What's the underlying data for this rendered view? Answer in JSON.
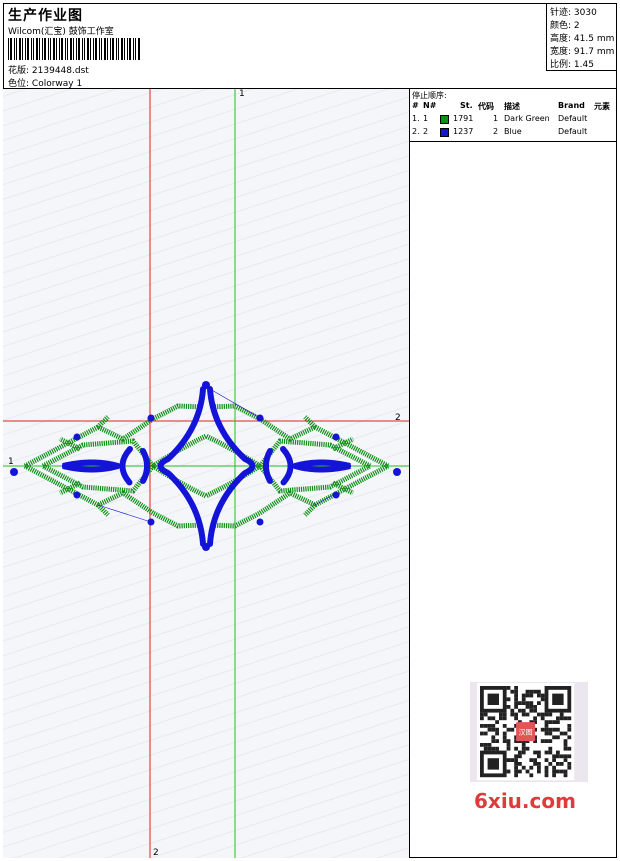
{
  "header": {
    "title": "生产作业图",
    "company": "Wilcom(汇宝) 鼓饰工作室",
    "file_label": "花版:",
    "file_value": "2139448.dst",
    "colorway_label": "色位:",
    "colorway_value": "Colorway 1"
  },
  "stats": [
    {
      "label": "针迹:",
      "value": "3030"
    },
    {
      "label": "颜色:",
      "value": "2"
    },
    {
      "label": "高度:",
      "value": "41.5 mm"
    },
    {
      "label": "宽度:",
      "value": "91.7 mm"
    },
    {
      "label": "比例:",
      "value": "1.45"
    }
  ],
  "stop_sequence": {
    "title": "停止顺序:",
    "columns": [
      "#",
      "N#",
      "St.",
      "代码",
      "描述",
      "Brand",
      "元素"
    ],
    "rows": [
      {
        "num": "1.",
        "n": "1",
        "color": "#0f8f17",
        "stitches": "1791",
        "code": "1",
        "desc": "Dark Green",
        "brand": "Default"
      },
      {
        "num": "2.",
        "n": "2",
        "color": "#1414d9",
        "stitches": "1237",
        "code": "2",
        "desc": "Blue",
        "brand": "Default"
      }
    ]
  },
  "canvas": {
    "marker_green_1": "1",
    "marker_green_1b": "1",
    "marker_red_2": "2",
    "marker_red_2b": "2",
    "green_color": "#0f8f17",
    "blue_color": "#1414d9",
    "red_color": "#e02020"
  },
  "watermark": {
    "qr_badge": "汉图",
    "site": "6xiu.com"
  }
}
